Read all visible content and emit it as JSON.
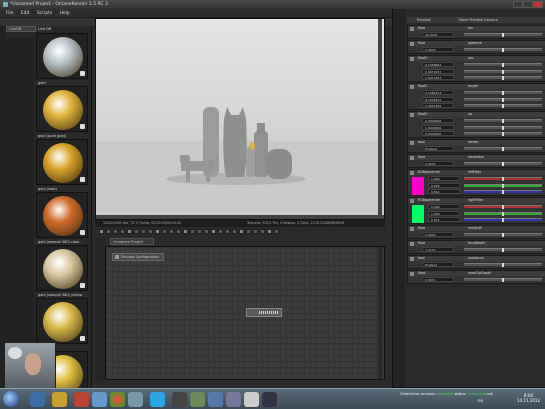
{
  "window": {
    "title": "*Unnamed Project - OctaneRender 1.5 RC 3"
  },
  "menu": [
    "File",
    "Edit",
    "Scripts",
    "Help"
  ],
  "material_panel": {
    "tab": "LiveDB",
    "tree_label": "Live DB",
    "materials": [
      {
        "label": "",
        "color": "#b9c3c8"
      },
      {
        "label": "gold",
        "color": "#e0b33a"
      },
      {
        "label": "gold (pure gold)",
        "color": "#d9a32a"
      },
      {
        "label": "gold (rose)",
        "color": "#d06a2a"
      },
      {
        "label": "gold (sample 580) cake-sett...",
        "color": "#d8c8a0"
      },
      {
        "label": "gold (sample 580) yellow",
        "color": "#d9b84a"
      },
      {
        "label": "",
        "color": "#e0c040"
      }
    ]
  },
  "viewport": {
    "status_left": "1024x1000 size, 79.7/ Fishes, 00:00:00/00:00:44",
    "status_right": "Textures: 302/1 Tris, 0 Meshes, 2 Optix, 22.61/2048MB/VRAM"
  },
  "node_graph": {
    "tab": "Unnamed Project",
    "config_label": "Preview Configuration"
  },
  "inspector": {
    "header_a": "Preview",
    "header_b": "Mesh Preview Camera",
    "rows": [
      {
        "name": "float",
        "label": "fov",
        "fields": [
          "45.0000"
        ]
      },
      {
        "name": "float",
        "label": "aperture",
        "fields": [
          "0.0000"
        ]
      },
      {
        "name": "float3",
        "label": "pos",
        "fields": [
          "0.1458604",
          "0.3672097",
          "1.5470397"
        ]
      },
      {
        "name": "float3",
        "label": "target",
        "fields": [
          "0.1580473",
          "0.1476421",
          "0.0052785"
        ]
      },
      {
        "name": "float3",
        "label": "up",
        "fields": [
          "0.0000000",
          "1.0000000",
          "0.0000000"
        ]
      },
      {
        "name": "bool",
        "label": "stereo",
        "fields": [
          "Enabled"
        ]
      },
      {
        "name": "float",
        "label": "stereodist",
        "fields": [
          "0.0200"
        ]
      },
      {
        "name": "RGBspectrum",
        "label": "leftFilter",
        "fields": [
          "1.000",
          "0.000",
          "0.812"
        ],
        "swatch": "#ff00cc"
      },
      {
        "name": "RGBspectrum",
        "label": "rightFilter",
        "fields": [
          "0.000",
          "1.000",
          "0.812"
        ],
        "swatch": "#00ff66"
      },
      {
        "name": "float",
        "label": "lensShift",
        "fields": [
          "0.0000"
        ]
      },
      {
        "name": "float",
        "label": "focalDepth",
        "fields": [
          "7.4772"
        ]
      },
      {
        "name": "bool",
        "label": "autofocus",
        "fields": [
          "Enabled"
        ]
      },
      {
        "name": "float",
        "label": "nearClipDepth",
        "fields": [
          "0.0001"
        ]
      }
    ]
  },
  "statusbar": {
    "account": "OctaneLive account:",
    "activated": "activated",
    "status": "status:",
    "connected": "connected",
    "net": "net"
  },
  "taskbar": {
    "time": "8:04",
    "date": "14.11.2012",
    "lang": "EN"
  },
  "colors": {
    "accent_green": "#4cd44c",
    "gold": "#e0b33a"
  }
}
